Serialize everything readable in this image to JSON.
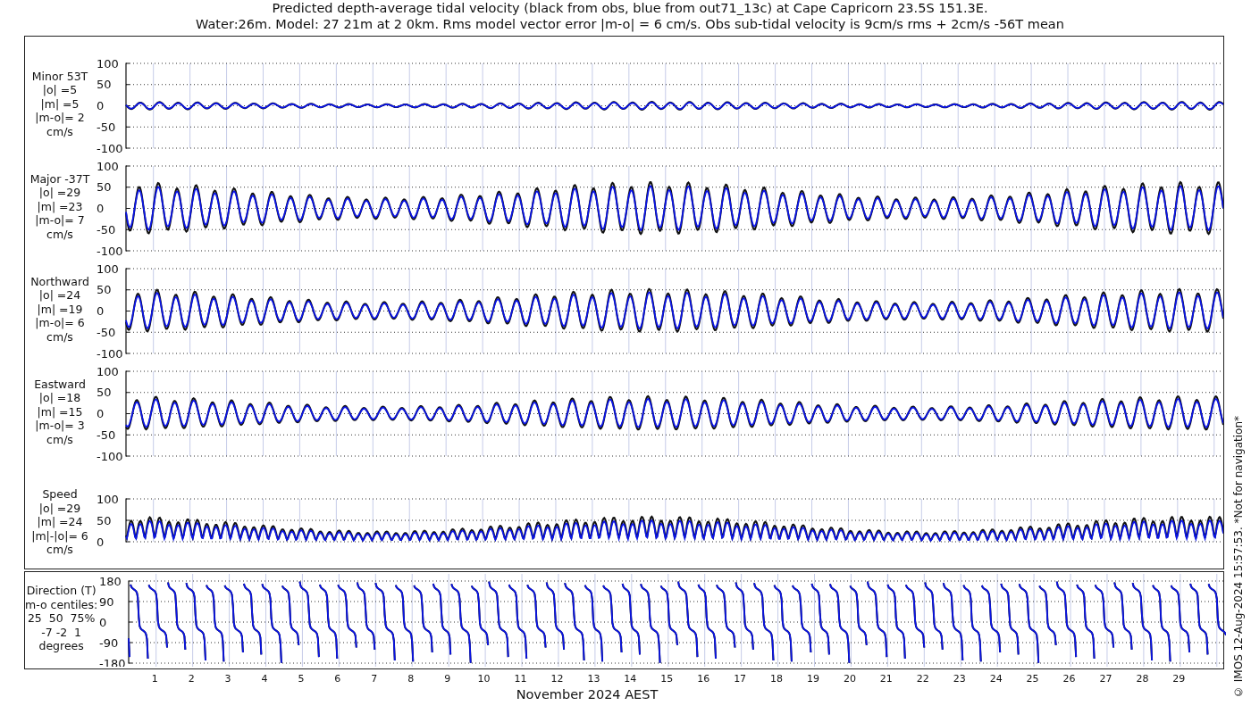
{
  "title": [
    "Predicted depth-average tidal velocity (black from obs, blue from out71_13c) at Cape Capricorn 23.5S 151.3E.",
    "Water:26m. Model: 27 21m at 2 0km. Rms model vector error |m-o| = 6 cm/s. Obs sub-tidal velocity is 9cm/s rms + 2cm/s -56T mean"
  ],
  "panels": [
    {
      "kind": "velocity",
      "label": [
        "Minor 53T",
        "|o| =5",
        "|m| =5",
        "|m-o|= 2",
        "cm/s"
      ],
      "yticks": [
        "100",
        "50",
        "0",
        "-50",
        "-100"
      ]
    },
    {
      "kind": "velocity",
      "label": [
        "Major -37T",
        "|o| =29",
        "|m| =23",
        "|m-o|= 7",
        "cm/s"
      ],
      "yticks": [
        "100",
        "50",
        "0",
        "-50",
        "-100"
      ]
    },
    {
      "kind": "velocity",
      "label": [
        "Northward",
        "|o| =24",
        "|m| =19",
        "|m-o|= 6",
        "cm/s"
      ],
      "yticks": [
        "100",
        "50",
        "0",
        "-50",
        "-100"
      ]
    },
    {
      "kind": "velocity",
      "label": [
        "Eastward",
        "|o| =18",
        "|m| =15",
        "|m-o|= 3",
        "cm/s"
      ],
      "yticks": [
        "100",
        "50",
        "0",
        "-50",
        "-100"
      ]
    },
    {
      "kind": "speed",
      "label": [
        "Speed",
        "|o| =29",
        "|m| =24",
        "|m|-|o|= 6",
        "cm/s"
      ],
      "yticks": [
        "100",
        "50",
        "0"
      ]
    }
  ],
  "direction": {
    "kind": "direction",
    "label": [
      "Direction (T)",
      "m-o centiles:",
      "25  50  75%",
      "-7 -2  1",
      "degrees"
    ],
    "yticks": [
      "180",
      "90",
      "0",
      "-90",
      "-180"
    ]
  },
  "xticks": [
    "1",
    "2",
    "3",
    "4",
    "5",
    "6",
    "7",
    "8",
    "9",
    "10",
    "11",
    "12",
    "13",
    "14",
    "15",
    "16",
    "17",
    "18",
    "19",
    "20",
    "21",
    "22",
    "23",
    "24",
    "25",
    "26",
    "27",
    "28",
    "29"
  ],
  "xlabel": "November 2024 AEST",
  "credit": "© IMOS 12-Aug-2024 15:57:53. *Not for navigation*"
}
